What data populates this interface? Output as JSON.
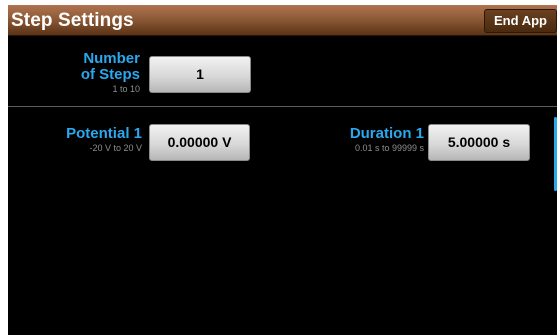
{
  "header": {
    "title": "Step Settings",
    "end_app_label": "End App"
  },
  "steps": {
    "label_line1": "Number",
    "label_line2": "of Steps",
    "range": "1 to 10",
    "value": "1"
  },
  "potential": {
    "label": "Potential 1",
    "range": "-20 V to 20 V",
    "value": "0.00000 V"
  },
  "duration": {
    "label": "Duration 1",
    "range": "0.01 s to 99999 s",
    "value": "5.00000 s"
  },
  "colors": {
    "label": "#2aa8ee",
    "titlebar": "#8e5a37",
    "background": "#000000"
  }
}
